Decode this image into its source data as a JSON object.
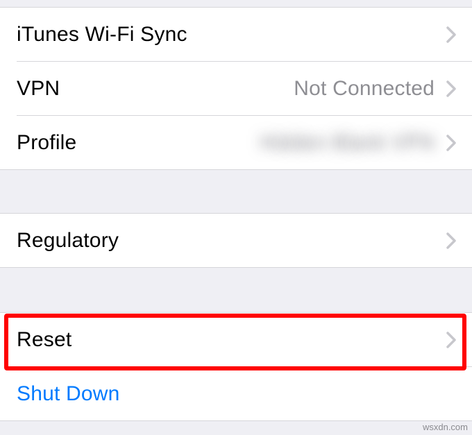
{
  "group1": {
    "itunes": {
      "label": "iTunes Wi-Fi Sync"
    },
    "vpn": {
      "label": "VPN",
      "value": "Not Connected"
    },
    "profile": {
      "label": "Profile",
      "value": "Hidden Blank VPN"
    }
  },
  "group2": {
    "regulatory": {
      "label": "Regulatory"
    }
  },
  "group3": {
    "reset": {
      "label": "Reset"
    },
    "shutdown": {
      "label": "Shut Down"
    }
  },
  "watermark": "wsxdn.com"
}
